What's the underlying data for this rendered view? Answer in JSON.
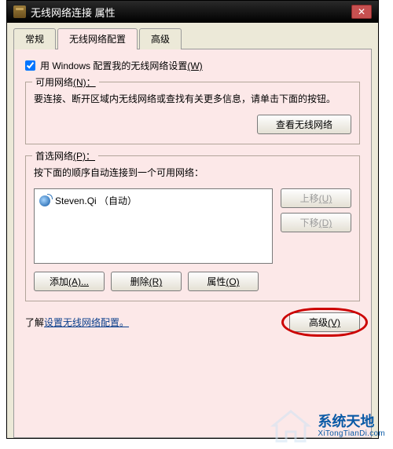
{
  "window": {
    "title": "无线网络连接 属性"
  },
  "tabs": {
    "general": "常规",
    "wireless": "无线网络配置",
    "advanced": "高级",
    "activeIndex": 1
  },
  "checkbox": {
    "label": "用 Windows 配置我的无线网络设置",
    "accel": "(W)"
  },
  "available": {
    "legend": "可用网络",
    "accel": "(N)：",
    "desc": "要连接、断开区域内无线网络或查找有关更多信息，请单击下面的按钮。",
    "viewBtn": "查看无线网络"
  },
  "preferred": {
    "legend": "首选网络",
    "accel": "(P)：",
    "desc": "按下面的顺序自动连接到一个可用网络：",
    "items": [
      {
        "name": "Steven.Qi （自动）"
      }
    ],
    "moveUp": "上移",
    "moveUpAccel": "(U)",
    "moveDown": "下移",
    "moveDownAccel": "(D)",
    "add": "添加",
    "addAccel": "(A)...",
    "remove": "删除",
    "removeAccel": "(R)",
    "props": "属性",
    "propsAccel": "(O)"
  },
  "footer": {
    "learnPrefix": "了解",
    "learnLink": "设置无线网络配置。",
    "advBtn": "高级",
    "advAccel": "(V)"
  },
  "watermark": {
    "cn": "系统天地",
    "en": "XiTongTianDi.com"
  }
}
